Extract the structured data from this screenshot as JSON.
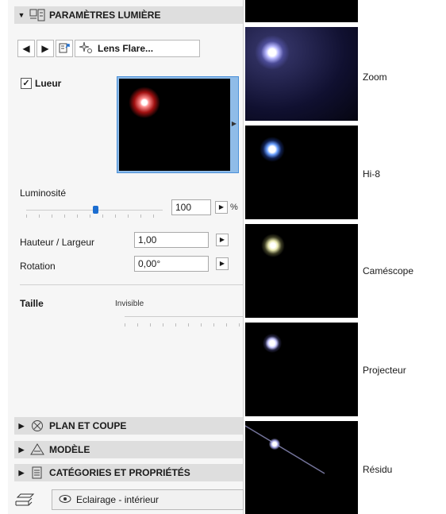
{
  "panel": {
    "header_title": "PARAMÈTRES LUMIÈRE",
    "lens_button_label": "Lens Flare...",
    "lueur_label": "Lueur",
    "lueur_checked": "✓",
    "luminosite_label": "Luminosité",
    "luminosite_value": "100",
    "luminosite_unit": "%",
    "hauteur_label": "Hauteur / Largeur",
    "hauteur_value": "1,00",
    "rotation_label": "Rotation",
    "rotation_value": "0,00°",
    "taille_label": "Taille",
    "taille_hint": "Invisible"
  },
  "sections": [
    {
      "label": "PLAN ET COUPE",
      "icon": "circle-x-icon"
    },
    {
      "label": "MODÈLE",
      "icon": "triangle-model-icon"
    },
    {
      "label": "CATÉGORIES ET PROPRIÉTÉS",
      "icon": "document-list-icon"
    }
  ],
  "footer": {
    "label": "Eclairage - intérieur",
    "icon": "eye-icon"
  },
  "presets": [
    {
      "label": "Zoom"
    },
    {
      "label": "Hi-8"
    },
    {
      "label": "Caméscope"
    },
    {
      "label": "Projecteur"
    },
    {
      "label": "Résidu"
    }
  ]
}
